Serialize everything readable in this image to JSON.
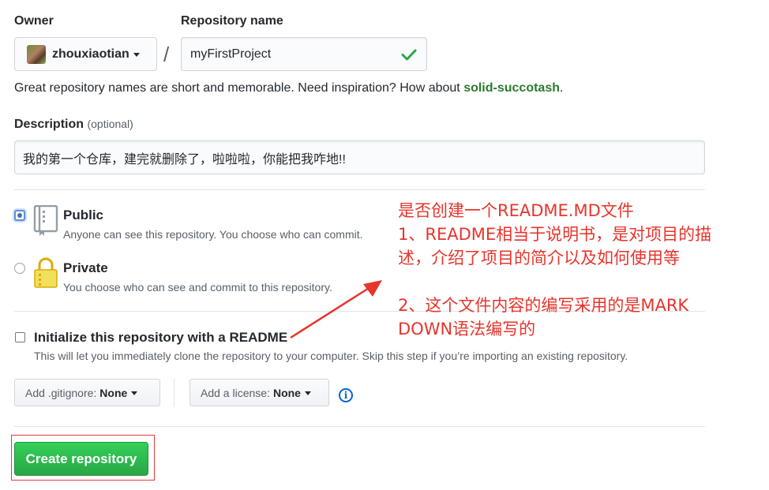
{
  "owner": {
    "label": "Owner",
    "name": "zhouxiaotian"
  },
  "repository": {
    "label": "Repository name",
    "value": "myFirstProject",
    "separator": "/"
  },
  "hint": {
    "text": "Great repository names are short and memorable. Need inspiration? How about ",
    "suggestion": "solid-succotash",
    "end": "."
  },
  "description": {
    "label": "Description",
    "optional": "(optional)",
    "value": "我的第一个仓库，建完就删除了，啦啦啦，你能把我咋地!!"
  },
  "visibility": {
    "public": {
      "title": "Public",
      "subtitle": "Anyone can see this repository. You choose who can commit.",
      "selected": true
    },
    "private": {
      "title": "Private",
      "subtitle": "You choose who can see and commit to this repository.",
      "selected": false
    }
  },
  "readme": {
    "title": "Initialize this repository with a README",
    "subtitle": "This will let you immediately clone the repository to your computer. Skip this step if you’re importing an existing repository.",
    "checked": false
  },
  "gitignore": {
    "label": "Add .gitignore:",
    "value": "None"
  },
  "license": {
    "label": "Add a license:",
    "value": "None"
  },
  "info_glyph": "i",
  "create_button": "Create repository",
  "annotation": {
    "line1": "是否创建一个README.MD文件",
    "line2": "1、README相当于说明书，是对项目的描",
    "line3": "述，介绍了项目的简介以及如何使用等",
    "line4": "2、这个文件内容的编写采用的是MARK",
    "line5": "DOWN语法编写的",
    "color": "#e8342b"
  },
  "colors": {
    "accent_green": "#28a745",
    "link_blue": "#0366d6"
  }
}
